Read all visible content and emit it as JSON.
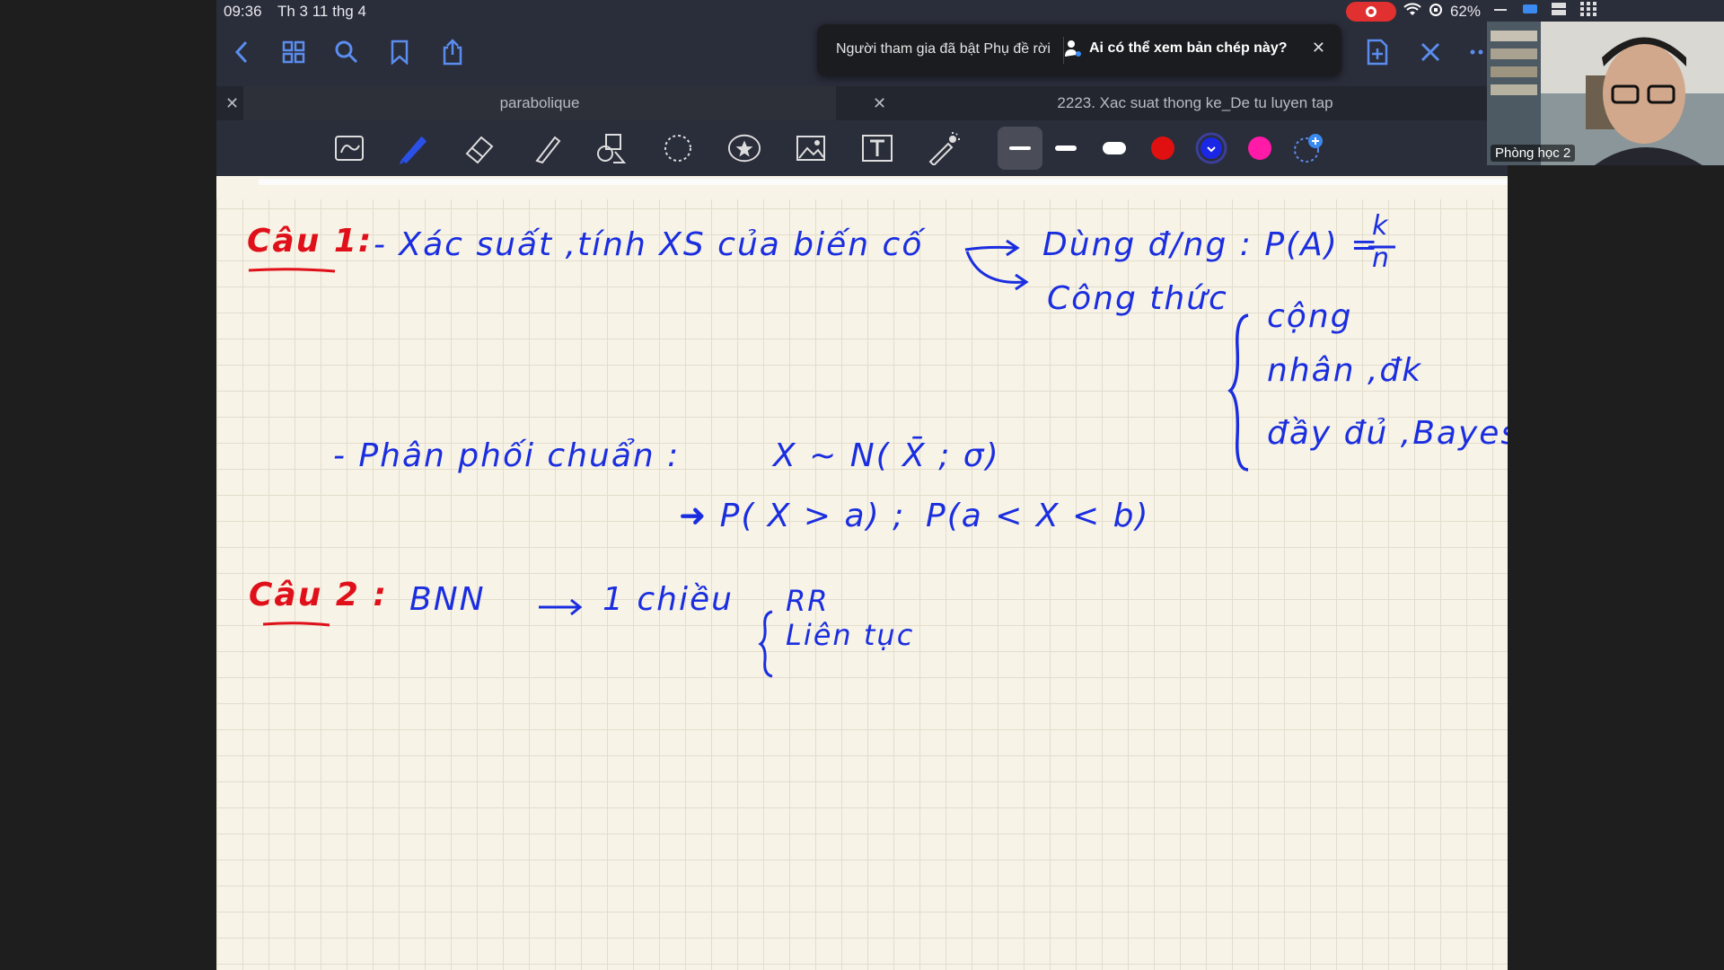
{
  "status": {
    "time": "09:36",
    "date": "Th 3 11 thg 4",
    "battery": "62%"
  },
  "toast": {
    "message": "Người tham gia đã bật Phụ đề rời",
    "question": "Ai có thể xem bản chép này?"
  },
  "tabs": [
    {
      "label": "parabolique"
    },
    {
      "label": "2223. Xac suat thong ke_De tu luyen tap"
    }
  ],
  "colors": {
    "ink_blue": "#1a2ee0",
    "ink_red": "#e0101a",
    "accent": "#5a8dee",
    "swatch_red": "#e01010",
    "swatch_blue": "#1a28e6",
    "swatch_pink": "#ff1aa8"
  },
  "notes": {
    "cau1": "Câu 1:",
    "l1": "- Xác suất ,tính XS của biến cố",
    "l1b": "Dùng đ/ng : P(A) =",
    "frac_k": "k",
    "frac_n": "n",
    "l2": "Công thức",
    "l2a": "cộng",
    "l2b": "nhân ,đk",
    "l2c": "đầy đủ ,Bayes",
    "l3": "- Phân phối chuẩn :",
    "l3b": "X ~ N( X̄ ; σ)",
    "l4": "➜ P( X > a) ;",
    "l4b": "P(a < X < b)",
    "cau2": "Câu 2 :",
    "l5": "BNN",
    "l5b": "1 chiều",
    "l5c": "RR",
    "l5d": "Liên tục"
  },
  "video": {
    "name": "Phòng học 2"
  }
}
